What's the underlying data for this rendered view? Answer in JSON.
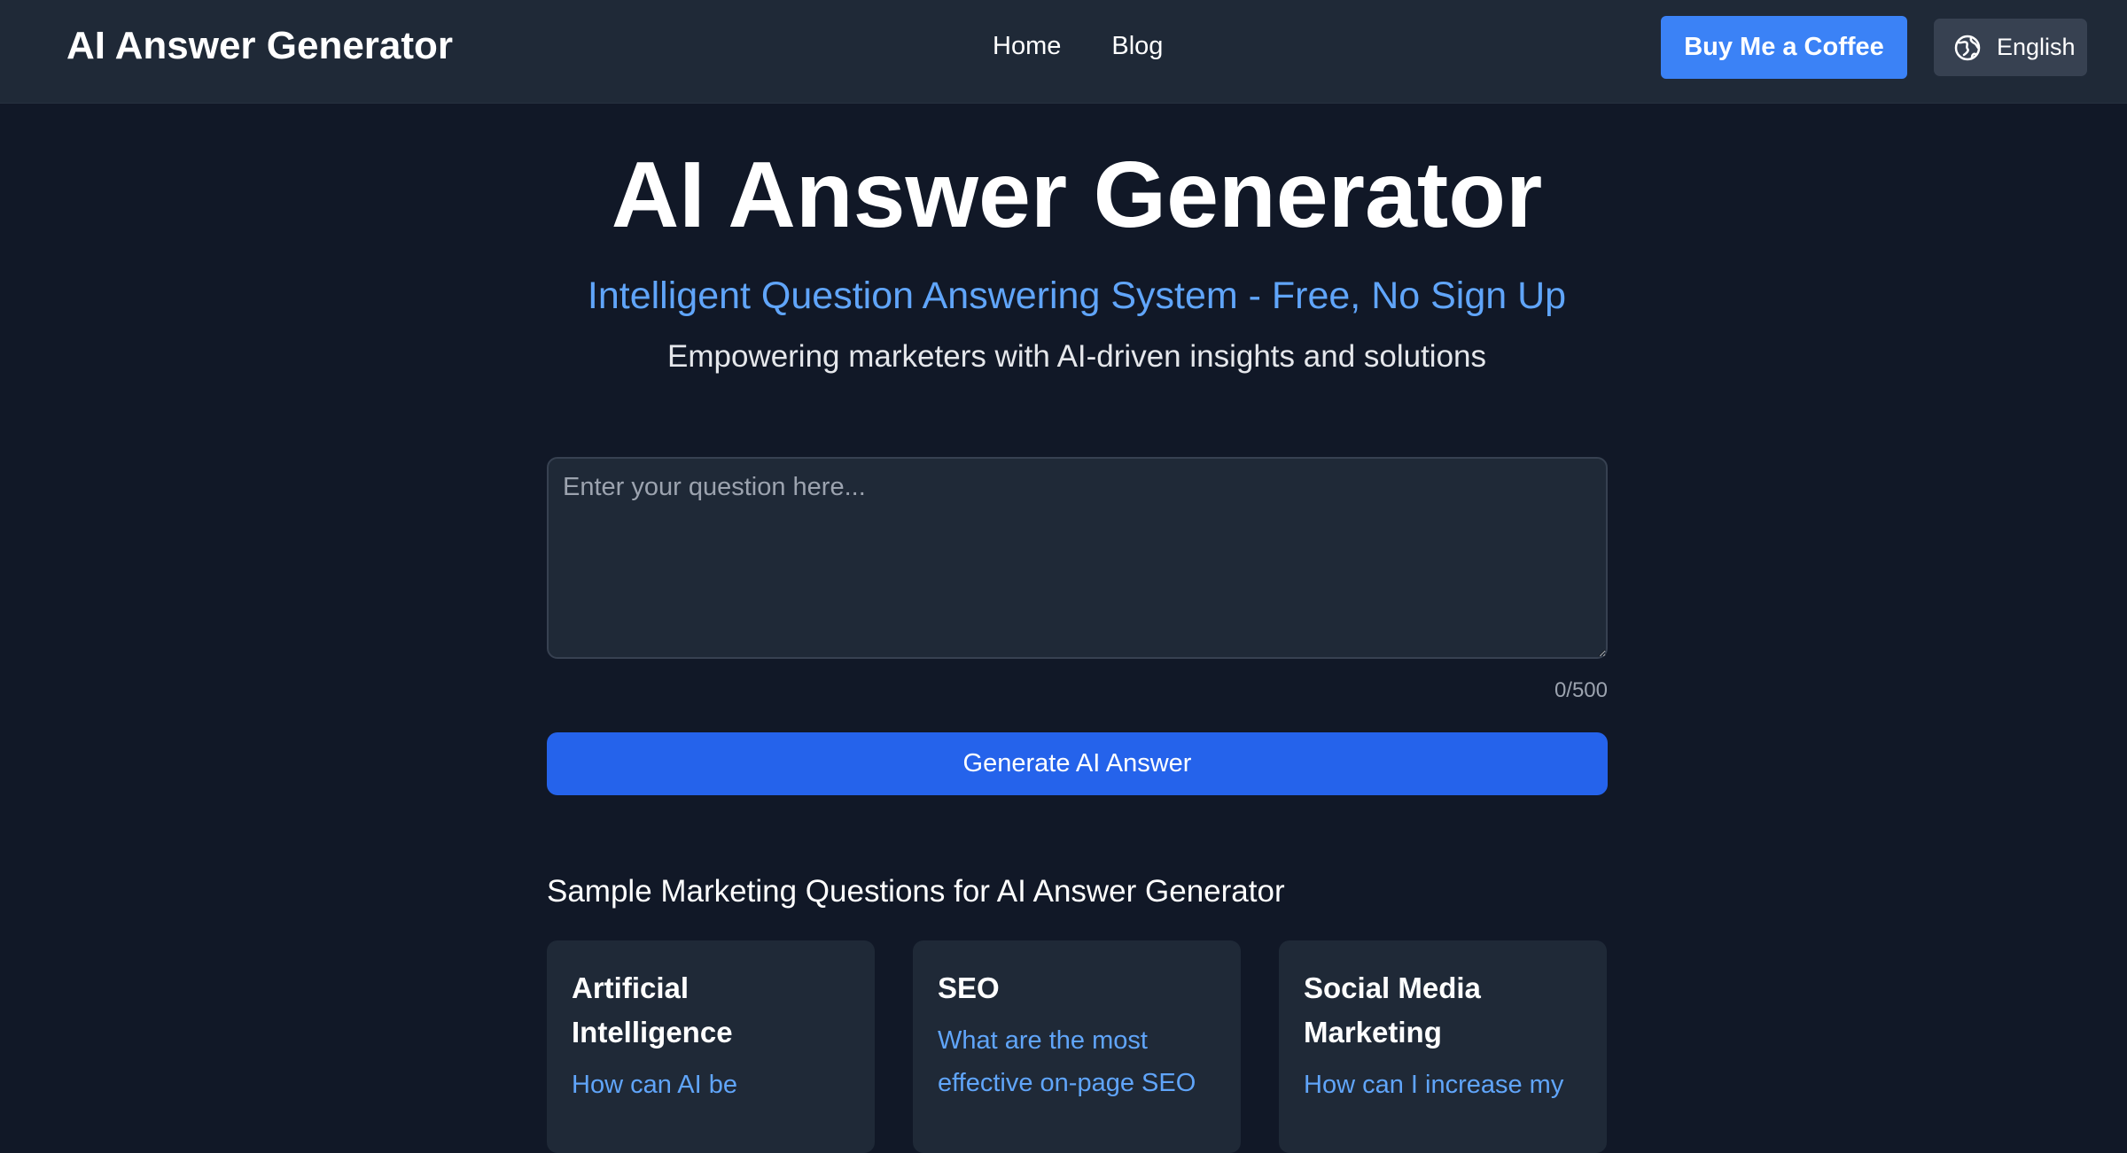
{
  "header": {
    "brand": "AI Answer Generator",
    "nav": [
      {
        "label": "Home"
      },
      {
        "label": "Blog"
      }
    ],
    "coffee_label": "Buy Me a Coffee",
    "language_label": "English"
  },
  "hero": {
    "title": "AI Answer Generator",
    "subtitle": "Intelligent Question Answering System - Free, No Sign Up",
    "tagline": "Empowering marketers with AI-driven insights and solutions"
  },
  "form": {
    "placeholder": "Enter your question here...",
    "value": "",
    "char_count": "0/500",
    "generate_label": "Generate AI Answer"
  },
  "samples": {
    "heading": "Sample Marketing Questions for AI Answer Generator",
    "cards": [
      {
        "title": "Artificial Intelligence",
        "question": "How can AI be"
      },
      {
        "title": "SEO",
        "question": "What are the most effective on-page SEO"
      },
      {
        "title": "Social Media Marketing",
        "question": "How can I increase my"
      }
    ]
  },
  "colors": {
    "background": "#111827",
    "header_bg": "#1f2937",
    "accent": "#3b82f6",
    "primary_button": "#2563eb",
    "link": "#60a5fa"
  },
  "icons": {
    "language": "globe-icon"
  }
}
